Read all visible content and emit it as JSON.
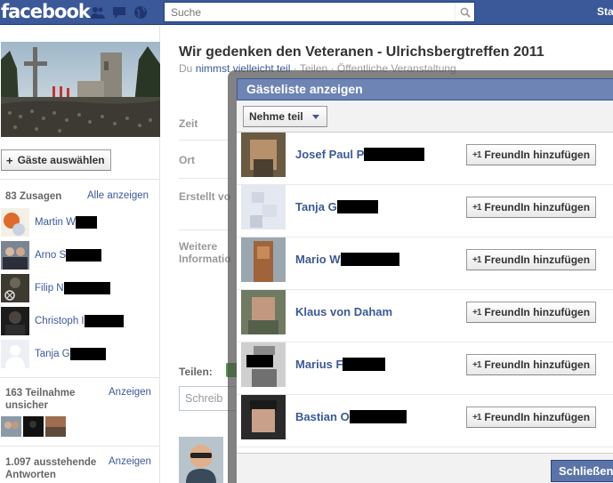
{
  "topbar": {
    "logo": "facebook",
    "search_placeholder": "Suche",
    "start_link": "Sta"
  },
  "left": {
    "add_guests_label": "Gäste auswählen",
    "attending": {
      "heading": "83 Zusagen",
      "link": "Alle anzeigen",
      "people": [
        {
          "name": "Martin W",
          "redact_w": 24
        },
        {
          "name": "Arno S",
          "redact_w": 40
        },
        {
          "name": "Filip N",
          "redact_w": 52
        },
        {
          "name": "Christoph I",
          "redact_w": 44
        },
        {
          "name": "Tanja G",
          "redact_w": 40
        }
      ]
    },
    "maybe": {
      "heading": "163 Teilnahme unsicher",
      "link": "Anzeigen"
    },
    "pending": {
      "heading": "1.097 ausstehende Antworten",
      "link": "Anzeigen"
    }
  },
  "main": {
    "title": "Wir gedenken den Veteranen - Ulrichsbergtreffen 2011",
    "subtitle_prefix": "Du ",
    "subtitle_link": "nimmst vielleicht teil",
    "subtitle_rest": " · Teilen · Öffentliche Veranstaltung",
    "labels": {
      "time": "Zeit",
      "place": "Ort",
      "created": "Erstellt vo",
      "more": "Weitere Informatio"
    },
    "share_label": "Teilen:",
    "write_placeholder": "Schreib"
  },
  "dialog": {
    "title": "Gästeliste anzeigen",
    "filter_label": "Nehme teil",
    "add_friend_label": "FreundIn hinzufügen",
    "add_friend_icon": "+1",
    "close_label": "Schließen",
    "guests": [
      {
        "name": "Josef Paul P",
        "redact_w": 68
      },
      {
        "name": "Tanja G",
        "redact_w": 46
      },
      {
        "name": "Mario W",
        "redact_w": 66
      },
      {
        "name": "Klaus von Daham",
        "redact_w": 0
      },
      {
        "name": "Marius F",
        "redact_w": 48
      },
      {
        "name": "Bastian O",
        "redact_w": 64
      }
    ]
  },
  "colors": {
    "brand_blue": "#3b5998",
    "dialog_header": "#6d84b4",
    "link": "#3b5998"
  }
}
